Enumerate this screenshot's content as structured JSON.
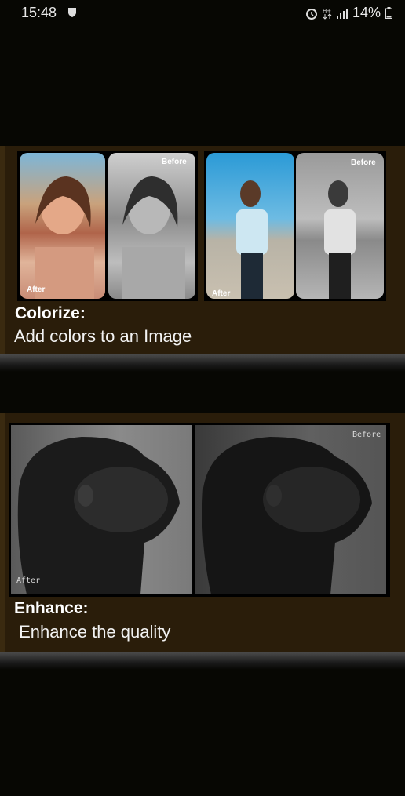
{
  "status_bar": {
    "time": "15:48",
    "battery": "14%",
    "icons": [
      "shield-icon",
      "alarm-icon",
      "data-icon",
      "signal-icon",
      "battery-icon"
    ]
  },
  "features": [
    {
      "title": "Colorize:",
      "description": "Add colors to an Image",
      "before_label": "Before",
      "after_label": "After"
    },
    {
      "title": "Enhance:",
      "description": " Enhance the quality",
      "before_label": "Before",
      "after_label": "After"
    }
  ]
}
